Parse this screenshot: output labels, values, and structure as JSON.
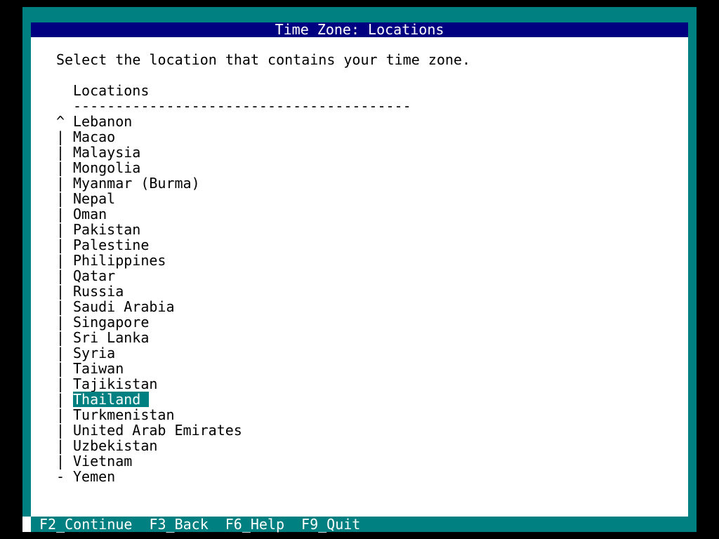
{
  "title": "Time Zone: Locations",
  "prompt": "Select the location that contains your time zone.",
  "list_header": "Locations",
  "list_rule": "----------------------------------------",
  "locations": [
    {
      "marker": "^",
      "label": "Lebanon"
    },
    {
      "marker": "|",
      "label": "Macao"
    },
    {
      "marker": "|",
      "label": "Malaysia"
    },
    {
      "marker": "|",
      "label": "Mongolia"
    },
    {
      "marker": "|",
      "label": "Myanmar (Burma)"
    },
    {
      "marker": "|",
      "label": "Nepal"
    },
    {
      "marker": "|",
      "label": "Oman"
    },
    {
      "marker": "|",
      "label": "Pakistan"
    },
    {
      "marker": "|",
      "label": "Palestine"
    },
    {
      "marker": "|",
      "label": "Philippines"
    },
    {
      "marker": "|",
      "label": "Qatar"
    },
    {
      "marker": "|",
      "label": "Russia"
    },
    {
      "marker": "|",
      "label": "Saudi Arabia"
    },
    {
      "marker": "|",
      "label": "Singapore"
    },
    {
      "marker": "|",
      "label": "Sri Lanka"
    },
    {
      "marker": "|",
      "label": "Syria"
    },
    {
      "marker": "|",
      "label": "Taiwan"
    },
    {
      "marker": "|",
      "label": "Tajikistan"
    },
    {
      "marker": "|",
      "label": "Thailand",
      "selected": true
    },
    {
      "marker": "|",
      "label": "Turkmenistan"
    },
    {
      "marker": "|",
      "label": "United Arab Emirates"
    },
    {
      "marker": "|",
      "label": "Uzbekistan"
    },
    {
      "marker": "|",
      "label": "Vietnam"
    },
    {
      "marker": "-",
      "label": "Yemen"
    }
  ],
  "status_bar": {
    "keys": [
      "F2_Continue",
      "F3_Back",
      "F6_Help",
      "F9_Quit"
    ]
  },
  "colors": {
    "frame": "#008080",
    "title_bar": "#000080",
    "window": "#ffffff",
    "selection": "#008080",
    "screen": "#000000"
  }
}
